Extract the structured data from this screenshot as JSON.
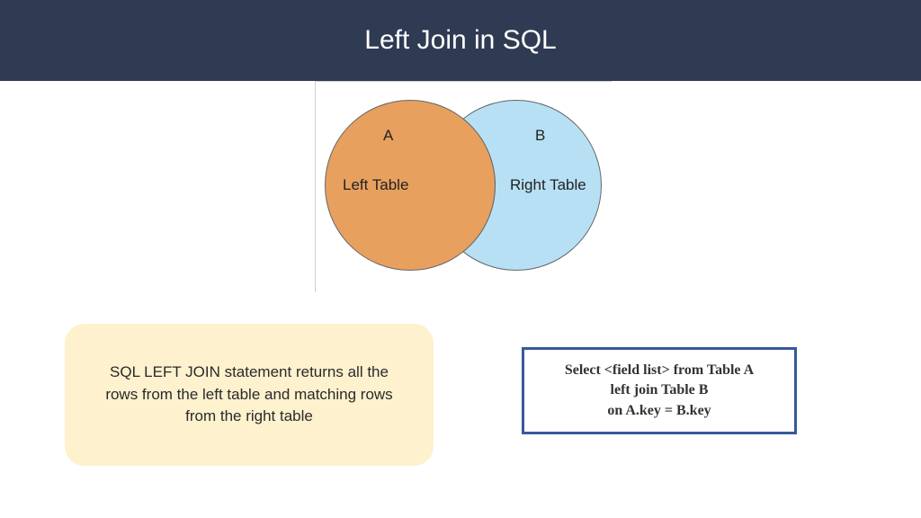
{
  "header": {
    "title": "Left Join in SQL"
  },
  "venn": {
    "labelA": "A",
    "labelB": "B",
    "leftTable": "Left Table",
    "rightTable": "Right Table"
  },
  "description": "SQL LEFT JOIN statement returns all the rows from the left table and matching rows from the right table",
  "code": {
    "line1": "Select <field list> from Table A",
    "line2": "left join Table B",
    "line3": "on A.key = B.key"
  }
}
